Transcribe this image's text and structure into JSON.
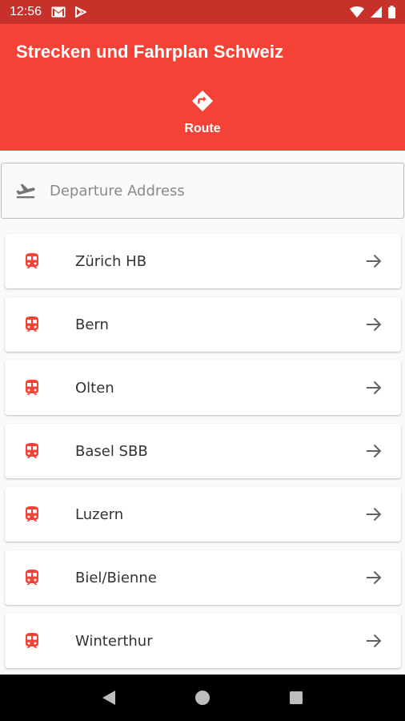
{
  "status_bar": {
    "time": "12:56",
    "icons": [
      "gmail-icon",
      "play-store-icon",
      "wifi-icon",
      "cellular-icon",
      "battery-icon"
    ]
  },
  "app_bar": {
    "title": "Strecken und Fahrplan Schweiz",
    "tab": {
      "label": "Route",
      "icon": "directions-icon"
    }
  },
  "search": {
    "placeholder": "Departure Address",
    "value": "",
    "icon": "flight-takeoff-icon"
  },
  "stations": [
    {
      "label": "Zürich HB",
      "icon": "train-icon"
    },
    {
      "label": "Bern",
      "icon": "train-icon"
    },
    {
      "label": "Olten",
      "icon": "train-icon"
    },
    {
      "label": "Basel SBB",
      "icon": "train-icon"
    },
    {
      "label": "Luzern",
      "icon": "train-icon"
    },
    {
      "label": "Biel/Bienne",
      "icon": "train-icon"
    },
    {
      "label": "Winterthur",
      "icon": "train-icon"
    }
  ],
  "nav_bar": {
    "icons": [
      "back-icon",
      "home-icon",
      "recents-icon"
    ]
  },
  "colors": {
    "primary": "#f44336",
    "status_bar": "#c8302a",
    "accent_icon": "#f44336"
  }
}
